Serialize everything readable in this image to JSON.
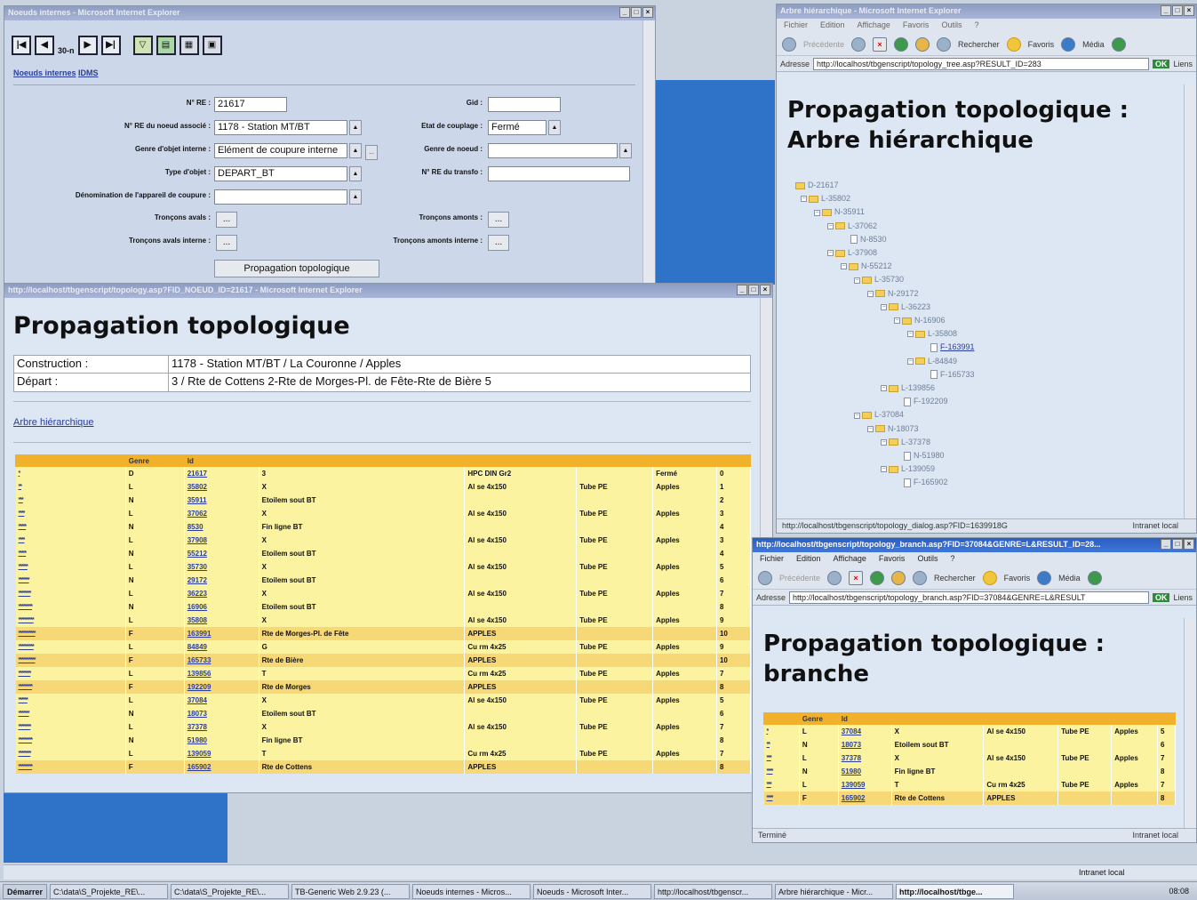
{
  "win_nodes": {
    "title": "Noeuds internes - Microsoft Internet Explorer",
    "page_label": "30-n",
    "link_noeuds": "Noeuds internes",
    "link_idms": "IDMS",
    "labels": {
      "no_re": "N° RE :",
      "no_re_noeud": "N° RE du noeud associé :",
      "genre_objet": "Genre d'objet interne :",
      "type_objet": "Type d'objet :",
      "denomination": "Dénomination de l'appareil de coupure :",
      "troncons_avals": "Tronçons avals :",
      "troncons_avals_int": "Tronçons avals interne :",
      "gid": "Gid :",
      "etat_couplage": "Etat de couplage :",
      "genre_noeud": "Genre de noeud :",
      "no_re_transfo": "N° RE du transfo :",
      "troncons_amonts": "Tronçons amonts :",
      "troncons_amonts_int": "Tronçons amonts interne :"
    },
    "values": {
      "no_re": "21617",
      "no_re_noeud": "1178 - Station MT/BT",
      "genre_objet": "Elément de coupure interne",
      "type_objet": "DEPART_BT",
      "etat_couplage": "Fermé"
    },
    "ellipsis": "...",
    "propagation_button": "Propagation topologique"
  },
  "win_main": {
    "title": "http://localhost/tbgenscript/topology.asp?FID_NOEUD_ID=21617 - Microsoft Internet Explorer",
    "heading": "Propagation topologique",
    "info": [
      {
        "label": "Construction :",
        "value": "1178 - Station MT/BT / La Couronne / Apples"
      },
      {
        "label": "Départ :",
        "value": "3 / Rte de Cottens 2-Rte de Morges-Pl. de Fête-Rte de Bière 5"
      }
    ],
    "link_arbre": "Arbre hiérarchique",
    "columns": [
      "",
      "Genre",
      "Id",
      "",
      "",
      "",
      "",
      ""
    ],
    "rows": [
      {
        "lev": "*",
        "genre": "D",
        "id": "21617",
        "desc": "3",
        "cable": "HPC DIN Gr2",
        "pose": "",
        "loc": "Fermé",
        "n": "0",
        "c": "y"
      },
      {
        "lev": "**",
        "genre": "L",
        "id": "35802",
        "desc": "X",
        "cable": "Al se 4x150",
        "pose": "Tube PE",
        "loc": "Apples",
        "n": "1",
        "c": "y"
      },
      {
        "lev": "***",
        "genre": "N",
        "id": "35911",
        "desc": "Etoilem sout BT",
        "cable": "",
        "pose": "",
        "loc": "",
        "n": "2",
        "c": "y"
      },
      {
        "lev": "****",
        "genre": "L",
        "id": "37062",
        "desc": "X",
        "cable": "Al se 4x150",
        "pose": "Tube PE",
        "loc": "Apples",
        "n": "3",
        "c": "y"
      },
      {
        "lev": "*****",
        "genre": "N",
        "id": "8530",
        "desc": "Fin ligne BT",
        "cable": "",
        "pose": "",
        "loc": "",
        "n": "4",
        "c": "y"
      },
      {
        "lev": "****",
        "genre": "L",
        "id": "37908",
        "desc": "X",
        "cable": "Al se 4x150",
        "pose": "Tube PE",
        "loc": "Apples",
        "n": "3",
        "c": "y"
      },
      {
        "lev": "*****",
        "genre": "N",
        "id": "55212",
        "desc": "Etoilem sout BT",
        "cable": "",
        "pose": "",
        "loc": "",
        "n": "4",
        "c": "y"
      },
      {
        "lev": "******",
        "genre": "L",
        "id": "35730",
        "desc": "X",
        "cable": "Al se 4x150",
        "pose": "Tube PE",
        "loc": "Apples",
        "n": "5",
        "c": "y"
      },
      {
        "lev": "*******",
        "genre": "N",
        "id": "29172",
        "desc": "Etoilem sout BT",
        "cable": "",
        "pose": "",
        "loc": "",
        "n": "6",
        "c": "y"
      },
      {
        "lev": "********",
        "genre": "L",
        "id": "36223",
        "desc": "X",
        "cable": "Al se 4x150",
        "pose": "Tube PE",
        "loc": "Apples",
        "n": "7",
        "c": "y"
      },
      {
        "lev": "*********",
        "genre": "N",
        "id": "16906",
        "desc": "Etoilem sout BT",
        "cable": "",
        "pose": "",
        "loc": "",
        "n": "8",
        "c": "y"
      },
      {
        "lev": "**********",
        "genre": "L",
        "id": "35808",
        "desc": "X",
        "cable": "Al se 4x150",
        "pose": "Tube PE",
        "loc": "Apples",
        "n": "9",
        "c": "y"
      },
      {
        "lev": "***********",
        "genre": "F",
        "id": "163991",
        "desc": "Rte de Morges-Pl. de Fête",
        "cable": "APPLES",
        "pose": "",
        "loc": "",
        "n": "10",
        "c": "o"
      },
      {
        "lev": "**********",
        "genre": "L",
        "id": "84849",
        "desc": "G",
        "cable": "Cu rm 4x25",
        "pose": "Tube PE",
        "loc": "Apples",
        "n": "9",
        "c": "y"
      },
      {
        "lev": "***********",
        "genre": "F",
        "id": "165733",
        "desc": "Rte de Bière",
        "cable": "APPLES",
        "pose": "",
        "loc": "",
        "n": "10",
        "c": "o"
      },
      {
        "lev": "********",
        "genre": "L",
        "id": "139856",
        "desc": "T",
        "cable": "Cu rm 4x25",
        "pose": "Tube PE",
        "loc": "Apples",
        "n": "7",
        "c": "y"
      },
      {
        "lev": "*********",
        "genre": "F",
        "id": "192209",
        "desc": "Rte de Morges",
        "cable": "APPLES",
        "pose": "",
        "loc": "",
        "n": "8",
        "c": "o"
      },
      {
        "lev": "******",
        "genre": "L",
        "id": "37084",
        "desc": "X",
        "cable": "Al se 4x150",
        "pose": "Tube PE",
        "loc": "Apples",
        "n": "5",
        "c": "y"
      },
      {
        "lev": "*******",
        "genre": "N",
        "id": "18073",
        "desc": "Etoilem sout BT",
        "cable": "",
        "pose": "",
        "loc": "",
        "n": "6",
        "c": "y"
      },
      {
        "lev": "********",
        "genre": "L",
        "id": "37378",
        "desc": "X",
        "cable": "Al se 4x150",
        "pose": "Tube PE",
        "loc": "Apples",
        "n": "7",
        "c": "y"
      },
      {
        "lev": "*********",
        "genre": "N",
        "id": "51980",
        "desc": "Fin ligne BT",
        "cable": "",
        "pose": "",
        "loc": "",
        "n": "8",
        "c": "y"
      },
      {
        "lev": "********",
        "genre": "L",
        "id": "139059",
        "desc": "T",
        "cable": "Cu rm 4x25",
        "pose": "Tube PE",
        "loc": "Apples",
        "n": "7",
        "c": "y"
      },
      {
        "lev": "*********",
        "genre": "F",
        "id": "165902",
        "desc": "Rte de Cottens",
        "cable": "APPLES",
        "pose": "",
        "loc": "",
        "n": "8",
        "c": "o"
      }
    ]
  },
  "win_tree": {
    "title": "Arbre hiérarchique - Microsoft Internet Explorer",
    "menu": [
      "Fichier",
      "Edition",
      "Affichage",
      "Favoris",
      "Outils",
      "?"
    ],
    "back": "Précédente",
    "search": "Rechercher",
    "favorites": "Favoris",
    "media": "Média",
    "address_label": "Adresse",
    "address": "http://localhost/tbgenscript/topology_tree.asp?RESULT_ID=283",
    "ok": "OK",
    "links": "Liens",
    "heading": "Propagation topologique : Arbre hiérarchique",
    "nodes": [
      {
        "t": "D-21617",
        "lvl": 0,
        "k": "root"
      },
      {
        "t": "L-35802",
        "lvl": 1,
        "k": "f"
      },
      {
        "t": "N-35911",
        "lvl": 2,
        "k": "f"
      },
      {
        "t": "L-37062",
        "lvl": 3,
        "k": "f"
      },
      {
        "t": "N-8530",
        "lvl": 4,
        "k": "d"
      },
      {
        "t": "L-37908",
        "lvl": 3,
        "k": "f"
      },
      {
        "t": "N-55212",
        "lvl": 4,
        "k": "f"
      },
      {
        "t": "L-35730",
        "lvl": 5,
        "k": "f"
      },
      {
        "t": "N-29172",
        "lvl": 6,
        "k": "f"
      },
      {
        "t": "L-36223",
        "lvl": 7,
        "k": "f"
      },
      {
        "t": "N-16906",
        "lvl": 8,
        "k": "f"
      },
      {
        "t": "L-35808",
        "lvl": 9,
        "k": "f"
      },
      {
        "t": "F-163991",
        "lvl": 10,
        "k": "d",
        "link": true
      },
      {
        "t": "L-84849",
        "lvl": 9,
        "k": "f"
      },
      {
        "t": "F-165733",
        "lvl": 10,
        "k": "d"
      },
      {
        "t": "L-139856",
        "lvl": 7,
        "k": "f"
      },
      {
        "t": "F-192209",
        "lvl": 8,
        "k": "d"
      },
      {
        "t": "L-37084",
        "lvl": 5,
        "k": "f"
      },
      {
        "t": "N-18073",
        "lvl": 6,
        "k": "f"
      },
      {
        "t": "L-37378",
        "lvl": 7,
        "k": "f"
      },
      {
        "t": "N-51980",
        "lvl": 8,
        "k": "d"
      },
      {
        "t": "L-139059",
        "lvl": 7,
        "k": "f"
      },
      {
        "t": "F-165902",
        "lvl": 8,
        "k": "d"
      }
    ],
    "status": "http://localhost/tbgenscript/topology_dialog.asp?FID=1639918G",
    "zone": "Intranet local"
  },
  "win_branch": {
    "title": "http://localhost/tbgenscript/topology_branch.asp?FID=37084&GENRE=L&RESULT_ID=28...",
    "menu": [
      "Fichier",
      "Edition",
      "Affichage",
      "Favoris",
      "Outils",
      "?"
    ],
    "back": "Précédente",
    "search": "Rechercher",
    "favorites": "Favoris",
    "media": "Média",
    "address_label": "Adresse",
    "address": "http://localhost/tbgenscript/topology_branch.asp?FID=37084&GENRE=L&RESULT",
    "ok": "OK",
    "links": "Liens",
    "heading": "Propagation topologique : branche",
    "columns": [
      "",
      "Genre",
      "Id",
      "",
      "",
      "",
      "",
      ""
    ],
    "rows": [
      {
        "lev": "*",
        "genre": "L",
        "id": "37084",
        "desc": "X",
        "cable": "Al se 4x150",
        "pose": "Tube PE",
        "loc": "Apples",
        "n": "5",
        "c": "y"
      },
      {
        "lev": "**",
        "genre": "N",
        "id": "18073",
        "desc": "Etoilem sout BT",
        "cable": "",
        "pose": "",
        "loc": "",
        "n": "6",
        "c": "y"
      },
      {
        "lev": "***",
        "genre": "L",
        "id": "37378",
        "desc": "X",
        "cable": "Al se 4x150",
        "pose": "Tube PE",
        "loc": "Apples",
        "n": "7",
        "c": "y"
      },
      {
        "lev": "****",
        "genre": "N",
        "id": "51980",
        "desc": "Fin ligne BT",
        "cable": "",
        "pose": "",
        "loc": "",
        "n": "8",
        "c": "y"
      },
      {
        "lev": "***",
        "genre": "L",
        "id": "139059",
        "desc": "T",
        "cable": "Cu rm 4x25",
        "pose": "Tube PE",
        "loc": "Apples",
        "n": "7",
        "c": "y"
      },
      {
        "lev": "****",
        "genre": "F",
        "id": "165902",
        "desc": "Rte de Cottens",
        "cable": "APPLES",
        "pose": "",
        "loc": "",
        "n": "8",
        "c": "o"
      }
    ],
    "status": "Terminé",
    "zone": "Intranet local"
  },
  "outer_status_zone": "Intranet local",
  "taskbar": {
    "start": "Démarrer",
    "tasks": [
      {
        "label": "C:\\data\\S_Projekte_RE\\...",
        "active": false
      },
      {
        "label": "C:\\data\\S_Projekte_RE\\...",
        "active": false
      },
      {
        "label": "TB-Generic Web 2.9.23 (...",
        "active": false
      },
      {
        "label": "Noeuds internes - Micros...",
        "active": false
      },
      {
        "label": "Noeuds - Microsoft Inter...",
        "active": false
      },
      {
        "label": "http://localhost/tbgenscr...",
        "active": false
      },
      {
        "label": "Arbre hiérarchique - Micr...",
        "active": false
      },
      {
        "label": "http://localhost/tbge...",
        "active": true
      }
    ],
    "clock": "08:08"
  }
}
